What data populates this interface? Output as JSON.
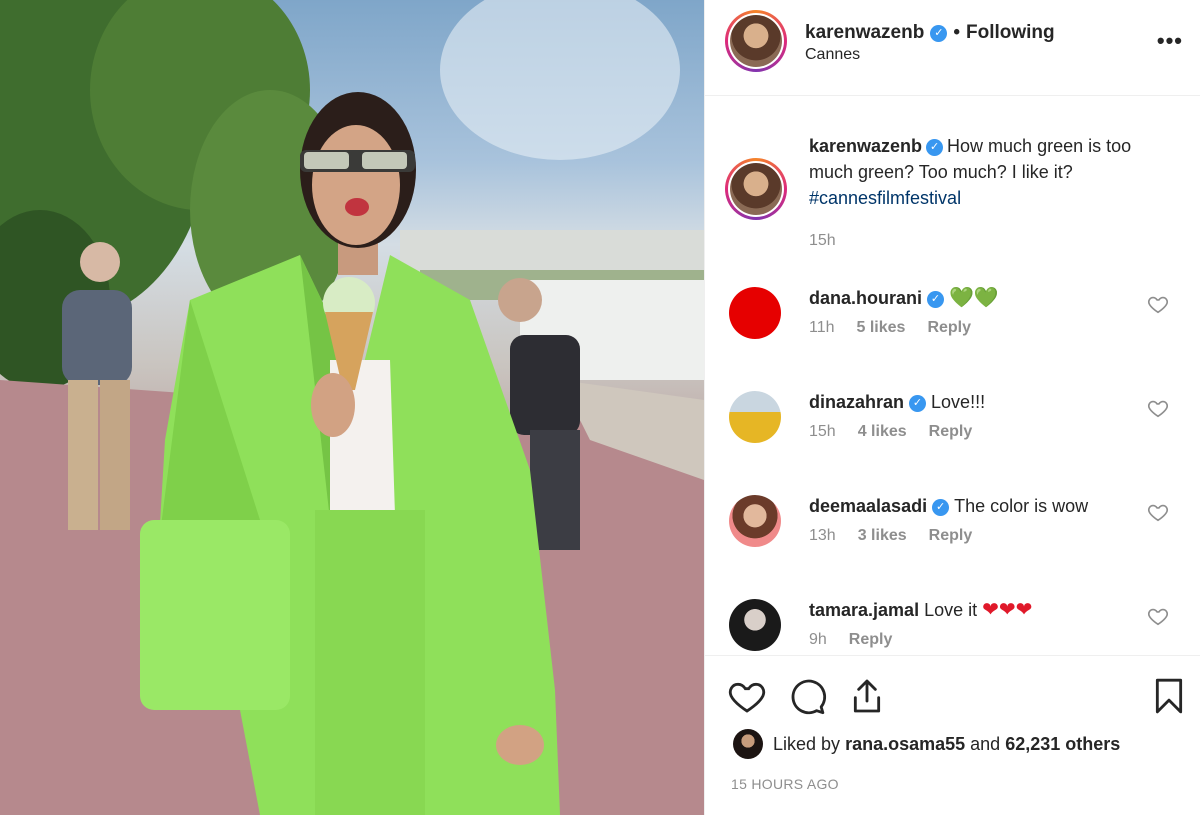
{
  "post": {
    "username": "karenwazenb",
    "verified_mark": "✓",
    "separator": "•",
    "follow_status": "Following",
    "location": "Cannes",
    "more_menu": "•••"
  },
  "caption": {
    "username": "karenwazenb",
    "text": "How much green is too much green? Too much? I like it?",
    "hashtag": "#cannesfilmfestival",
    "time": "15h"
  },
  "comments": [
    {
      "username": "dana.hourani",
      "verified": true,
      "text": "",
      "emoji": "💚💚",
      "time": "11h",
      "likes": "5 likes",
      "reply": "Reply",
      "avatar_color": "#e60000"
    },
    {
      "username": "dinazahran",
      "verified": true,
      "text": "Love!!!",
      "emoji": "",
      "time": "15h",
      "likes": "4 likes",
      "reply": "Reply"
    },
    {
      "username": "deemaalasadi",
      "verified": true,
      "text": "The color is wow",
      "emoji": "",
      "time": "13h",
      "likes": "3 likes",
      "reply": "Reply"
    },
    {
      "username": "tamara.jamal",
      "verified": false,
      "text": "Love it",
      "emoji": "❤❤❤",
      "time": "9h",
      "likes": "",
      "reply": "Reply"
    }
  ],
  "actions": {
    "icons": [
      "heart-icon",
      "comment-icon",
      "share-icon",
      "bookmark-icon"
    ],
    "liked_by_prefix": "Liked by",
    "liked_by_user": "rana.osama55",
    "liked_by_and": "and",
    "liked_by_others": "62,231 others",
    "post_time": "15 HOURS AGO"
  },
  "colors": {
    "link": "#003569",
    "verified": "#3897f0",
    "muted": "#8e8e8e",
    "jacket": "#8fe05a"
  }
}
